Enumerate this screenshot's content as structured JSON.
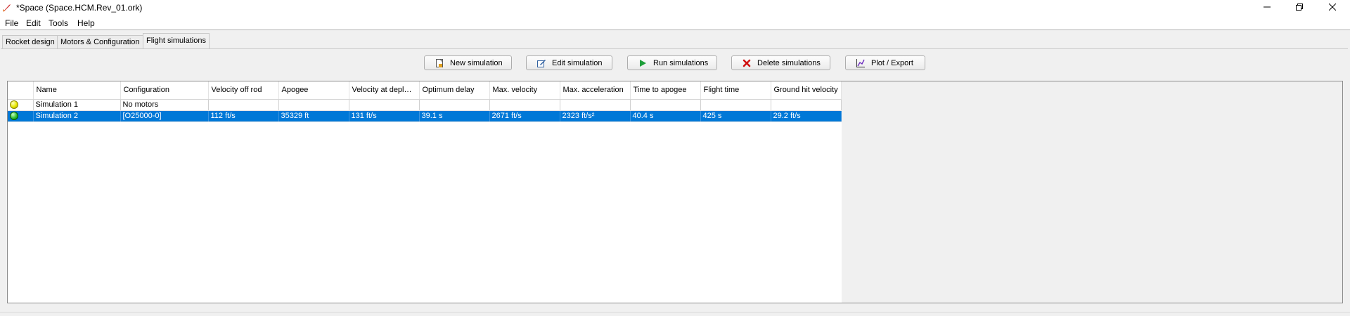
{
  "window": {
    "title": "*Space (Space.HCM.Rev_01.ork)",
    "icons": {
      "app": "rocket-icon",
      "minimize": "minimize-icon",
      "maximize": "restore-icon",
      "close": "close-icon"
    }
  },
  "menu": {
    "items": [
      "File",
      "Edit",
      "Tools",
      "Help"
    ]
  },
  "tabs": [
    {
      "label": "Rocket design",
      "active": false
    },
    {
      "label": "Motors & Configuration",
      "active": false
    },
    {
      "label": "Flight simulations",
      "active": true
    }
  ],
  "toolbar": {
    "new_label": "New simulation",
    "edit_label": "Edit simulation",
    "run_label": "Run simulations",
    "delete_label": "Delete simulations",
    "plot_label": "Plot / Export"
  },
  "table": {
    "columns": [
      "",
      "Name",
      "Configuration",
      "Velocity off rod",
      "Apogee",
      "Velocity at depl…",
      "Optimum delay",
      "Max. velocity",
      "Max. acceleration",
      "Time to apogee",
      "Flight time",
      "Ground hit velocity"
    ],
    "rows": [
      {
        "status": "outdated",
        "status_color": "#e8e800",
        "selected": false,
        "cells": [
          "Simulation 1",
          "No motors",
          "",
          "",
          "",
          "",
          "",
          "",
          "",
          "",
          ""
        ]
      },
      {
        "status": "up-to-date",
        "status_color": "#30c030",
        "selected": true,
        "cells": [
          "Simulation 2",
          "[O25000-0]",
          "112 ft/s",
          "35329 ft",
          "131 ft/s",
          "39.1 s",
          "2671 ft/s",
          "2323 ft/s²",
          "40.4 s",
          "425 s",
          "29.2 ft/s"
        ]
      }
    ]
  },
  "colors": {
    "selection": "#0078d7",
    "panel": "#f0f0f0"
  }
}
